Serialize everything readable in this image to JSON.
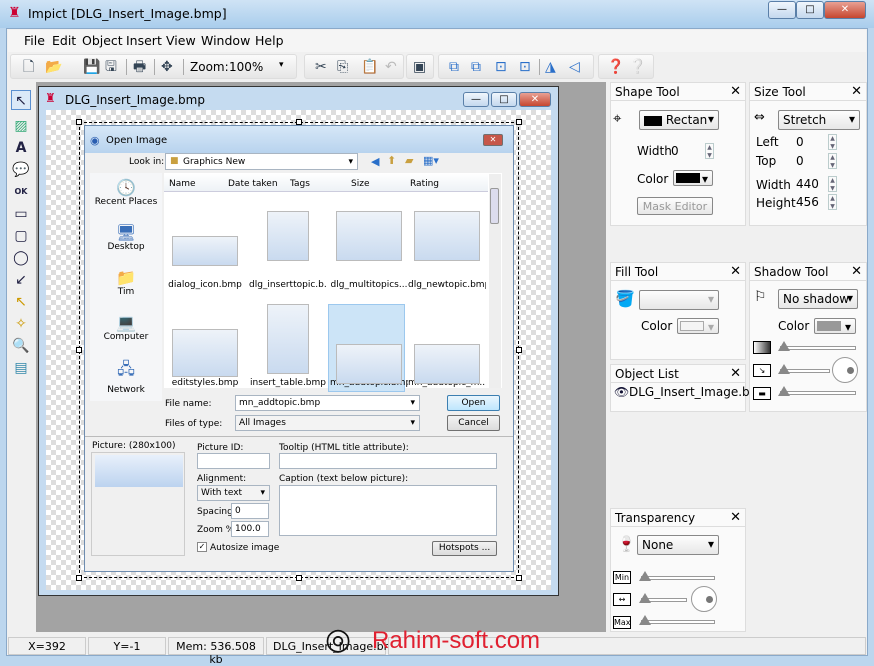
{
  "app": {
    "title": "Impict [DLG_Insert_Image.bmp]"
  },
  "menu": [
    "File",
    "Edit",
    "Object",
    "Insert",
    "View",
    "Window",
    "Help"
  ],
  "toolbar": {
    "zoom_label": "Zoom:",
    "zoom_value": "100%"
  },
  "child": {
    "title": "DLG_Insert_Image.bmp"
  },
  "dialog": {
    "title": "Open Image",
    "look_in_label": "Look in:",
    "look_in_value": "Graphics New",
    "places": [
      "Recent Places",
      "Desktop",
      "Tim",
      "Computer",
      "Network"
    ],
    "columns": [
      "Name",
      "Date taken",
      "Tags",
      "Size",
      "Rating"
    ],
    "files": [
      "dialog_icon.bmp",
      "dlg_inserttopic.b...",
      "dlg_multitopics...",
      "dlg_newtopic.bmp",
      "editstyles.bmp",
      "insert_table.bmp",
      "mn_addtopic.bmp",
      "mn_addtopic_m..."
    ],
    "file_name_label": "File name:",
    "file_name_value": "mn_addtopic.bmp",
    "file_type_label": "Files of type:",
    "file_type_value": "All Images",
    "open": "Open",
    "cancel": "Cancel",
    "picture_label": "Picture: (280x100)",
    "picture_id_label": "Picture ID:",
    "tooltip_label": "Tooltip (HTML title attribute):",
    "alignment_label": "Alignment:",
    "alignment_value": "With text",
    "caption_label": "Caption (text below picture):",
    "spacing_label": "Spacing:",
    "spacing_value": "0",
    "zoom_label": "Zoom %:",
    "zoom_value": "100.0",
    "autosize_label": "Autosize image",
    "hotspots": "Hotspots ..."
  },
  "shape_tool": {
    "title": "Shape Tool",
    "shape": "Rectan",
    "width_label": "Width",
    "width_value": "0",
    "color_label": "Color",
    "mask_editor": "Mask Editor"
  },
  "size_tool": {
    "title": "Size Tool",
    "mode": "Stretch",
    "left_label": "Left",
    "left": "0",
    "top_label": "Top",
    "top": "0",
    "width_label": "Width",
    "width": "440",
    "height_label": "Height",
    "height": "456"
  },
  "fill_tool": {
    "title": "Fill Tool",
    "color_label": "Color"
  },
  "shadow_tool": {
    "title": "Shadow Tool",
    "mode": "No shadow",
    "color_label": "Color"
  },
  "object_list": {
    "title": "Object List",
    "items": [
      "DLG_Insert_Image.bmp"
    ]
  },
  "transparency": {
    "title": "Transparency",
    "mode": "None",
    "min": "Min",
    "max": "Max"
  },
  "status": {
    "x": "X=392",
    "y": "Y=-1",
    "mem": "Mem: 536.508 kb",
    "file": "DLG_Insert_Image.bmp"
  },
  "watermark": "Rahim-soft.com",
  "colors": {
    "selection": "#cce4f7",
    "mdi_bg": "#a3a3a3"
  }
}
